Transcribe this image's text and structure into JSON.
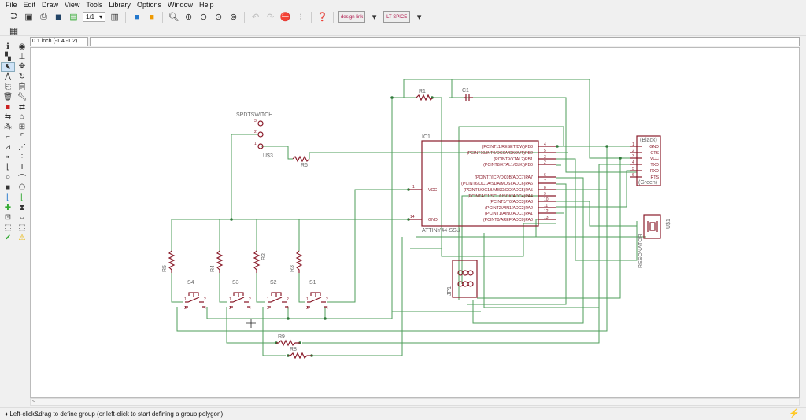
{
  "menu": [
    "File",
    "Edit",
    "Draw",
    "View",
    "Tools",
    "Library",
    "Options",
    "Window",
    "Help"
  ],
  "toolbar": {
    "icons": [
      "open-icon",
      "save-icon",
      "print-icon",
      "cam-icon",
      "sheet-icon"
    ],
    "sheet_select": "1/1",
    "icons2": [
      "library-icon",
      "board-icon",
      "switch-icon",
      "zoom-fit-icon",
      "zoom-in-icon",
      "zoom-out-icon",
      "zoom-select-icon",
      "redraw-icon",
      "undo-icon",
      "redo-icon",
      "stop-icon",
      "go-icon",
      "help-icon"
    ],
    "design_link": "design link",
    "lt_spice": "LT SPICE"
  },
  "toolbar2": {
    "grid_icon": "grid-icon"
  },
  "coord": "0.1 inch (-1.4 -1.2)",
  "left_tools": [
    "info",
    "show",
    "display",
    "mark",
    "group",
    "move",
    "mirror",
    "rotate",
    "copy",
    "paste",
    "delete",
    "change",
    "replace",
    "gateswap",
    "pinswap",
    "smash",
    "name",
    "value",
    "split",
    "miter",
    "optimize",
    "invoke",
    "label",
    "junction",
    "wire",
    "text",
    "circle",
    "arc",
    "rect",
    "polygon",
    "bus",
    "net",
    "add",
    "attribute",
    "frame",
    "dimension",
    "erc-prev",
    "erc-next",
    "erc",
    "errors"
  ],
  "schematic": {
    "spdt": {
      "name": "SPDTSWITCH",
      "ref": "U$3",
      "pins": [
        "3",
        "2",
        "1"
      ]
    },
    "resistors": [
      "R1",
      "R2",
      "R3",
      "R4",
      "R5",
      "R6",
      "R8",
      "R9"
    ],
    "capacitor": "C1",
    "switches": [
      "S4",
      "S3",
      "S2",
      "S1"
    ],
    "switch_pins": [
      "1",
      "2",
      "3",
      "4"
    ],
    "ic": {
      "ref": "IC1",
      "value": "ATTINY44-SSU",
      "left_pins": [
        {
          "name": "VCC",
          "num": "1"
        },
        {
          "name": "GND",
          "num": "14"
        }
      ],
      "right_pins": [
        {
          "name": "(PCINT11/RESET/DW)PB3",
          "num": "4"
        },
        {
          "name": "(PCINT10/INT0/OC0A/CKOUT)PB2",
          "num": "5"
        },
        {
          "name": "(PCINT9/XTAL2)PB1",
          "num": "3"
        },
        {
          "name": "(PCINT8/XTAL1/CLKI)PB0",
          "num": "2"
        },
        {
          "name": "(PCINT7/ICP/OC0B/ADC7)PA7",
          "num": "6"
        },
        {
          "name": "(PCINT6/OC1A/SDA/MOSI/ADC6)PA6",
          "num": "7"
        },
        {
          "name": "(PCINT5/OC1B/MISO/DO/ADC5)PA5",
          "num": "8"
        },
        {
          "name": "(PCINT4/T1/SCL/USCK/ADC4)PA4",
          "num": "9"
        },
        {
          "name": "(PCINT3/T0/ADC3)PA3",
          "num": "10"
        },
        {
          "name": "(PCINT2/AIN1/ADC2)PA2",
          "num": "11"
        },
        {
          "name": "(PCINT1/AIN0/ADC1)PA1",
          "num": "12"
        },
        {
          "name": "(PCINT0/AREF/ADC0)PA0",
          "num": "13"
        }
      ]
    },
    "ftdi": {
      "top": "(Black)",
      "bottom": "(Green)",
      "pins": [
        "GND",
        "CTS",
        "VCC",
        "TXD",
        "RXD",
        "RTS"
      ],
      "nums": [
        "1",
        "2",
        "3",
        "4",
        "5",
        "6"
      ]
    },
    "resonator": {
      "ref": "U$1",
      "value": "RESONATOR"
    },
    "isp": {
      "ref": "JP1"
    }
  },
  "scroll_left": "<",
  "status": "Left-click&drag to define group (or left-click to start defining a group polygon)",
  "colors": {
    "wire": "#4e9e5a",
    "symbol": "#8a1b2a",
    "label": "#666666"
  }
}
